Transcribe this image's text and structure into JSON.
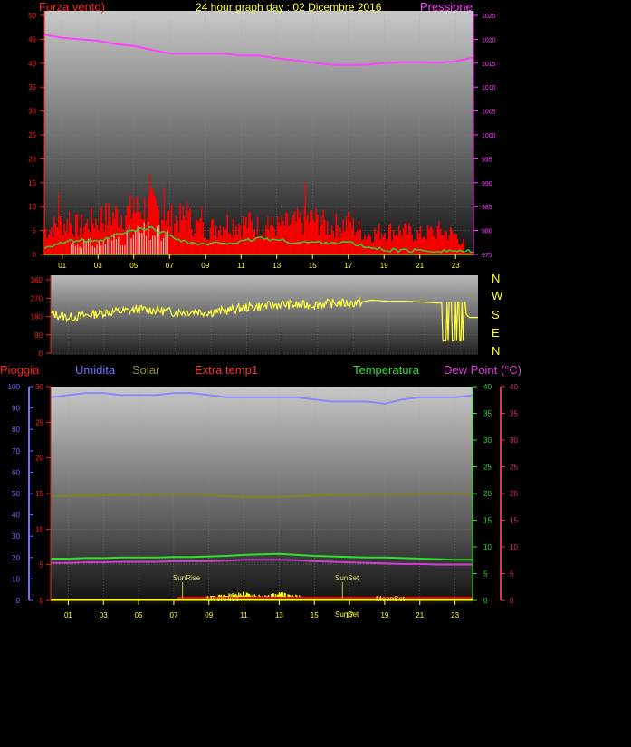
{
  "header": {
    "left_title": "Forza vento)",
    "center_title": "24 hour graph day : 02 Dicembre 2016",
    "right_title": "Pressione"
  },
  "colors": {
    "wind_axis": "#ff2020",
    "pressure_axis": "#ff40ff",
    "time_axis": "#ffff30",
    "wind_fill": "#ff0000",
    "gust_line": "#ff0000",
    "avg_wind": "#30d030",
    "gust_small": "#e8ffe8",
    "pressure_line": "#ff40ff",
    "direction_line": "#ffff40",
    "rain_axis": "#7070ff",
    "humidity_line": "#8888ff",
    "solar_line": "#808020",
    "extratemp": "#ff3030",
    "temp_line": "#30e030",
    "dew_line": "#d040d0",
    "solar_fill": "#ffff00",
    "rain_fill": "#ff0000"
  },
  "bottom_labels": {
    "pioggia": "Pioggia",
    "umidita": "Umidita",
    "solar": "Solar",
    "extra": "Extra temp1",
    "temperatura": "Temperatura",
    "dew": "Dew Point (°C)"
  },
  "annotations": {
    "sunrise": "SunRise",
    "sunset": "SunSet",
    "moonrise": "MoonRise",
    "moonset": "MoonSet",
    "sunset_bottom": "SunSet"
  },
  "compass": [
    "N",
    "W",
    "S",
    "E",
    "N"
  ],
  "chart_data": [
    {
      "type": "line",
      "id": "wind_pressure",
      "x_ticks": [
        "01",
        "03",
        "05",
        "07",
        "09",
        "11",
        "13",
        "15",
        "17",
        "19",
        "21",
        "23"
      ],
      "xlim": [
        0,
        24
      ],
      "left_axis": {
        "ylim": [
          0,
          50
        ],
        "ticks": [
          0,
          5,
          10,
          15,
          20,
          25,
          30,
          35,
          40,
          45,
          50
        ]
      },
      "right_axis": {
        "ylim": [
          975,
          1025
        ],
        "ticks": [
          975,
          980,
          985,
          990,
          995,
          1000,
          1005,
          1010,
          1015,
          1020,
          1025
        ]
      },
      "pressure": {
        "x": [
          0,
          1,
          2,
          3,
          4,
          5,
          6,
          7,
          8,
          9,
          10,
          11,
          12,
          13,
          14,
          15,
          16,
          17,
          18,
          19,
          20,
          21,
          22,
          23,
          24
        ],
        "y": [
          1021.0,
          1020.3,
          1020.0,
          1019.7,
          1019.0,
          1018.6,
          1017.8,
          1017.0,
          1017.0,
          1017.0,
          1017.0,
          1016.6,
          1016.6,
          1016.0,
          1015.6,
          1015.1,
          1014.7,
          1014.6,
          1014.7,
          1015.0,
          1015.2,
          1015.2,
          1015.1,
          1015.4,
          1016.2
        ]
      },
      "wind_max": {
        "x": [
          0,
          1,
          2,
          3,
          4,
          5,
          6,
          7,
          8,
          9,
          10,
          11,
          12,
          13,
          14,
          15,
          16,
          17,
          18,
          19,
          20,
          21,
          22,
          23,
          24
        ],
        "y": [
          6,
          8,
          7,
          9,
          10,
          11,
          12,
          9,
          9,
          6,
          8,
          8,
          7,
          7,
          8,
          9,
          7,
          8,
          5,
          6,
          6,
          5,
          6,
          5,
          0
        ]
      },
      "wind_peaks": [
        [
          0.8,
          13
        ],
        [
          1.4,
          9
        ],
        [
          3.2,
          10
        ],
        [
          5.0,
          12
        ],
        [
          5.9,
          17
        ],
        [
          6.7,
          14
        ],
        [
          8.0,
          11
        ],
        [
          8.8,
          10
        ],
        [
          11.5,
          9
        ],
        [
          12.5,
          8
        ],
        [
          14.6,
          15
        ],
        [
          15.5,
          8
        ],
        [
          17.0,
          9
        ]
      ],
      "avg_wind": {
        "x": [
          0,
          1,
          2,
          3,
          4,
          5,
          6,
          7,
          8,
          9,
          10,
          11,
          12,
          13,
          14,
          15,
          16,
          17,
          18,
          19,
          20,
          21,
          22,
          23,
          24
        ],
        "y": [
          1.5,
          2.5,
          3.0,
          2.5,
          4.0,
          5.0,
          5.5,
          4.0,
          2.5,
          2.0,
          2.5,
          2.5,
          3.5,
          3.0,
          2.5,
          2.5,
          2.5,
          2.5,
          1.5,
          1.0,
          0.8,
          0.8,
          0.8,
          0.8,
          0.5
        ]
      }
    },
    {
      "type": "line",
      "id": "wind_direction",
      "xlim": [
        0,
        24
      ],
      "ylim": [
        0,
        360
      ],
      "ticks": [
        0,
        90,
        180,
        270,
        360
      ],
      "x": [
        0,
        1,
        2,
        3,
        4,
        5,
        6,
        7,
        8,
        9,
        10,
        11,
        12,
        13,
        14,
        15,
        16,
        17,
        18,
        19,
        20,
        21,
        22,
        23,
        23.5,
        24
      ],
      "y": [
        195,
        175,
        185,
        200,
        205,
        215,
        210,
        200,
        205,
        200,
        210,
        225,
        230,
        240,
        235,
        240,
        245,
        245,
        260,
        255,
        255,
        250,
        245,
        225,
        175,
        175
      ]
    },
    {
      "type": "line",
      "id": "temp_humidity",
      "x_ticks": [
        "01",
        "03",
        "05",
        "07",
        "09",
        "11",
        "13",
        "15",
        "17",
        "19",
        "21",
        "23"
      ],
      "xlim": [
        0,
        24
      ],
      "left_axis_outer": {
        "label": "Pioggia",
        "ylim": [
          0,
          100
        ],
        "ticks": [
          0,
          10,
          20,
          30,
          40,
          50,
          60,
          70,
          80,
          90,
          100
        ]
      },
      "left_axis_inner": {
        "ylim": [
          0,
          30
        ],
        "ticks": [
          0,
          5,
          10,
          15,
          20,
          25,
          30
        ]
      },
      "right_axis_temp": {
        "ylim": [
          0,
          40
        ],
        "ticks": [
          0,
          5,
          10,
          15,
          20,
          25,
          30,
          35,
          40
        ]
      },
      "right_axis_dew": {
        "ylim": [
          0,
          40
        ],
        "ticks": [
          0,
          5,
          10,
          15,
          20,
          25,
          30,
          35,
          40
        ]
      },
      "humidity": {
        "x": [
          0,
          1,
          2,
          3,
          4,
          5,
          6,
          7,
          8,
          9,
          10,
          11,
          12,
          13,
          14,
          15,
          16,
          17,
          18,
          19,
          20,
          21,
          22,
          23,
          24
        ],
        "y": [
          95,
          96,
          97,
          97,
          96,
          96,
          96,
          97,
          97,
          96,
          95,
          95,
          95,
          95,
          95,
          94,
          93,
          93,
          93,
          92,
          94,
          95,
          95,
          95,
          96
        ]
      },
      "solar_avg": {
        "x": [
          0,
          2,
          4,
          6,
          8,
          10,
          12,
          14,
          16,
          18,
          20,
          22,
          24
        ],
        "y": [
          19.5,
          19.6,
          19.7,
          19.8,
          19.9,
          19.5,
          19.3,
          19.5,
          19.7,
          19.8,
          19.9,
          20.0,
          19.9
        ]
      },
      "temperature": {
        "x": [
          0,
          1,
          2,
          3,
          4,
          5,
          6,
          7,
          8,
          9,
          10,
          11,
          12,
          13,
          14,
          15,
          16,
          17,
          18,
          19,
          20,
          21,
          22,
          23,
          24
        ],
        "y": [
          7.8,
          7.8,
          7.9,
          7.9,
          8.0,
          8.0,
          8.0,
          8.1,
          8.1,
          8.2,
          8.3,
          8.5,
          8.6,
          8.7,
          8.5,
          8.3,
          8.2,
          8.1,
          8.0,
          8.0,
          7.9,
          7.8,
          7.7,
          7.6,
          7.6
        ]
      },
      "dew_point": {
        "x": [
          0,
          1,
          2,
          3,
          4,
          5,
          6,
          7,
          8,
          9,
          10,
          11,
          12,
          13,
          14,
          15,
          16,
          17,
          18,
          19,
          20,
          21,
          22,
          23,
          24
        ],
        "y": [
          7.0,
          7.0,
          7.1,
          7.1,
          7.2,
          7.2,
          7.2,
          7.3,
          7.3,
          7.3,
          7.4,
          7.6,
          7.6,
          7.6,
          7.5,
          7.3,
          7.2,
          7.1,
          7.0,
          6.9,
          6.8,
          6.8,
          6.7,
          6.7,
          6.7
        ]
      },
      "solar_peaks": {
        "x": [
          8.5,
          9.5,
          10.5,
          11.0,
          11.5,
          12.0,
          12.5,
          13.0,
          13.5,
          14.0,
          14.5,
          15.0
        ],
        "y": [
          0.5,
          0.8,
          1.1,
          1.5,
          0.9,
          0.8,
          0.9,
          1.3,
          1.0,
          0.8,
          0.6,
          0.3
        ]
      },
      "sunrise_x": 7.5,
      "sunset_x": 16.6
    }
  ]
}
